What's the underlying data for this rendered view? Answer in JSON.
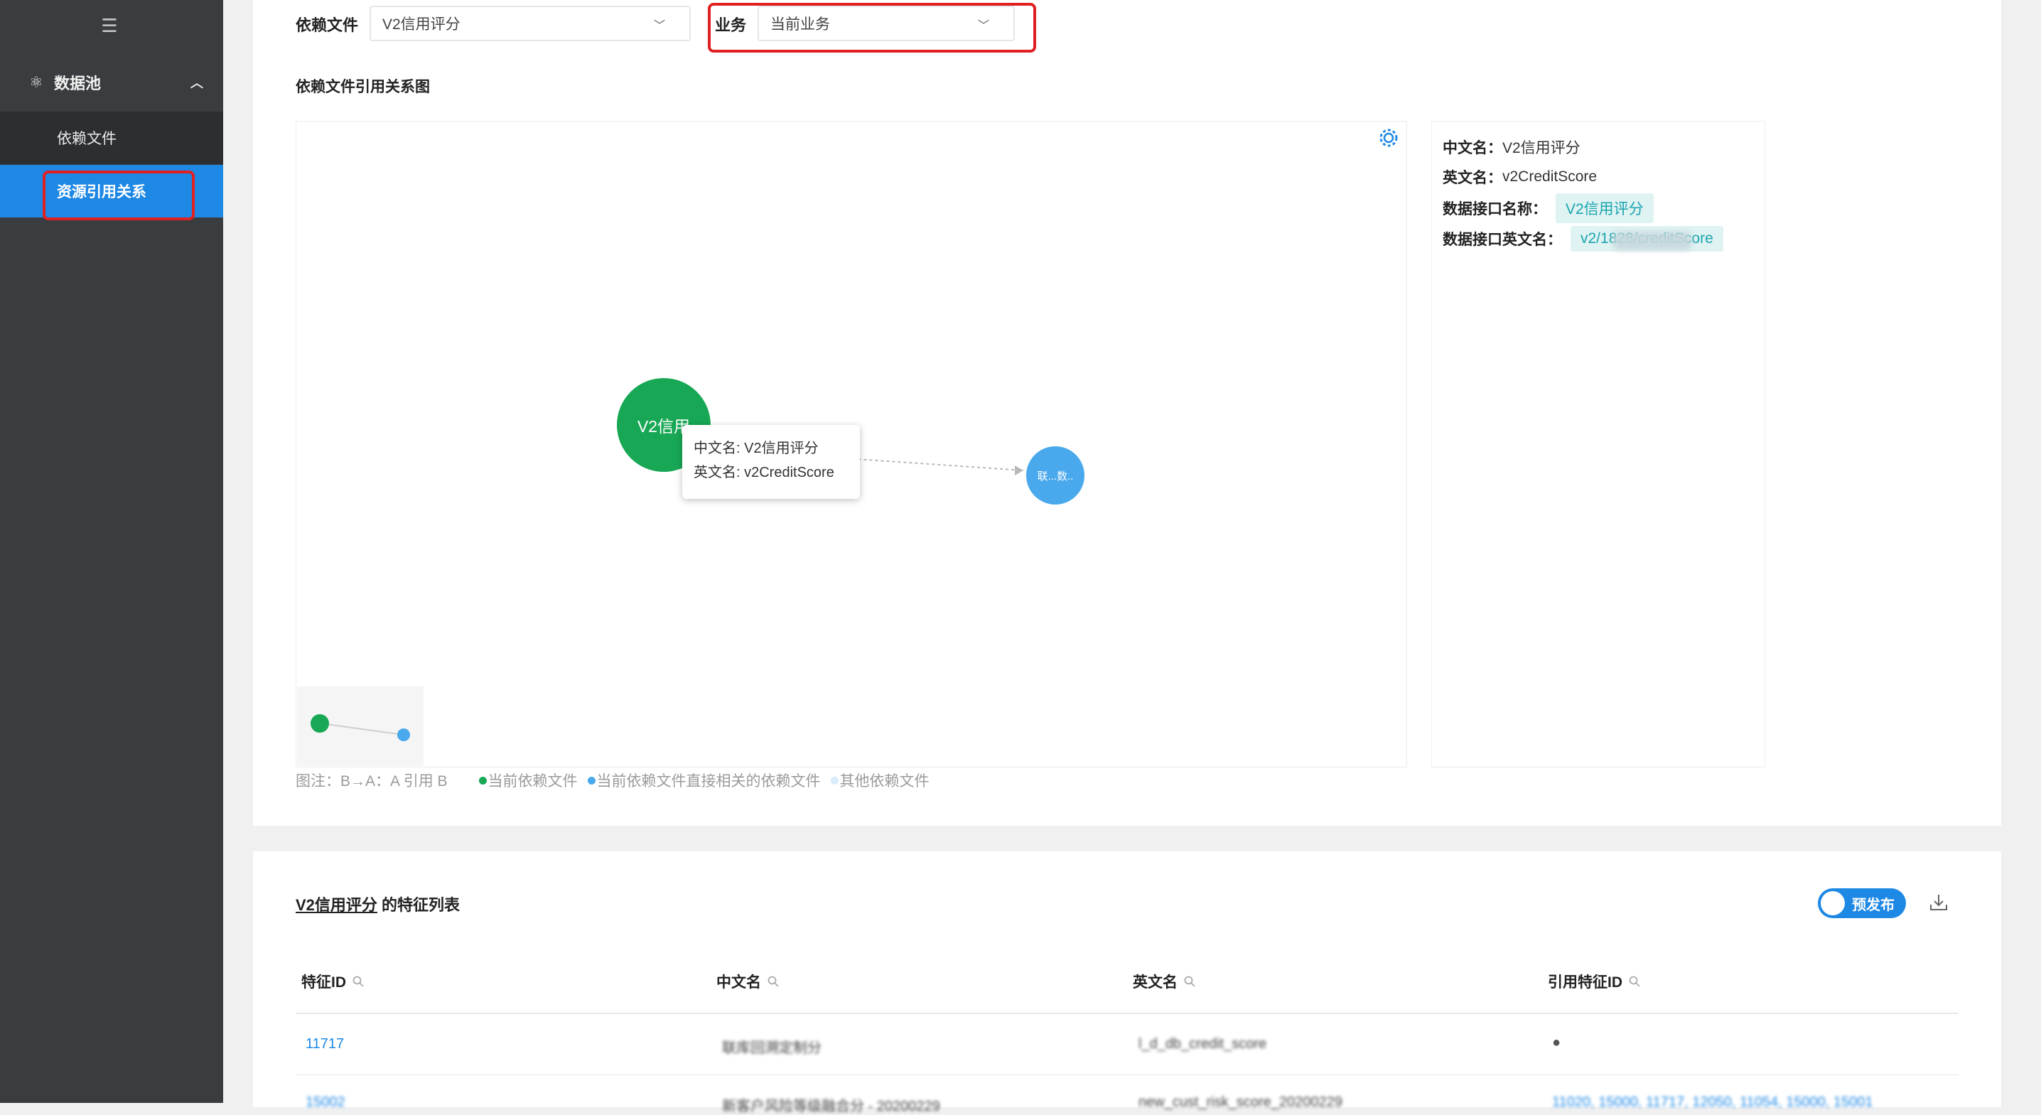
{
  "sidebar": {
    "collapse_icon": "menu-fold-icon",
    "group": {
      "icon": "data-pool-icon",
      "label": "数据池",
      "chevron": "chevron-up-icon"
    },
    "items": [
      {
        "label": "依赖文件",
        "active": false
      },
      {
        "label": "资源引用关系",
        "active": true
      }
    ]
  },
  "filters": {
    "dep_file_label": "依赖文件",
    "dep_file_value": "V2信用评分",
    "business_label": "业务",
    "business_value": "当前业务"
  },
  "graph": {
    "title": "依赖文件引用关系图",
    "main_node_label": "V2信用",
    "related_node_label": "联...数..",
    "tooltip": {
      "cn": "中文名: V2信用评分",
      "en": "英文名: v2CreditScore"
    },
    "legend": {
      "note": "图注：B→A：A 引用 B",
      "current": "当前依赖文件",
      "direct": "当前依赖文件直接相关的依赖文件",
      "other": "其他依赖文件"
    },
    "colors": {
      "current": "#18a855",
      "direct": "#4aa9ec",
      "other": "#d8ecfb"
    }
  },
  "detail": {
    "cn_key": "中文名：",
    "cn_val": "V2信用评分",
    "en_key": "英文名：",
    "en_val": "v2CreditScore",
    "api_name_key": "数据接口名称：",
    "api_name_val": "V2信用评分",
    "api_en_key": "数据接口英文名：",
    "api_en_val": "v2/1828/creditScore"
  },
  "features": {
    "title_link": "V2信用评分",
    "title_suffix": " 的特征列表",
    "toggle_label": "预发布",
    "columns": [
      "特征ID",
      "中文名",
      "英文名",
      "引用特征ID"
    ],
    "rows": [
      {
        "id": "11717",
        "cn": "联库回溯定制分",
        "en": "l_d_db_credit_score",
        "ref": "●"
      },
      {
        "id": "15002",
        "cn": "新客户风险等级融合分 - 20200229",
        "en": "new_cust_risk_score_20200229",
        "ref": "11020, 15000, 11717, 12050, 11054, 15000, 15001"
      }
    ]
  }
}
